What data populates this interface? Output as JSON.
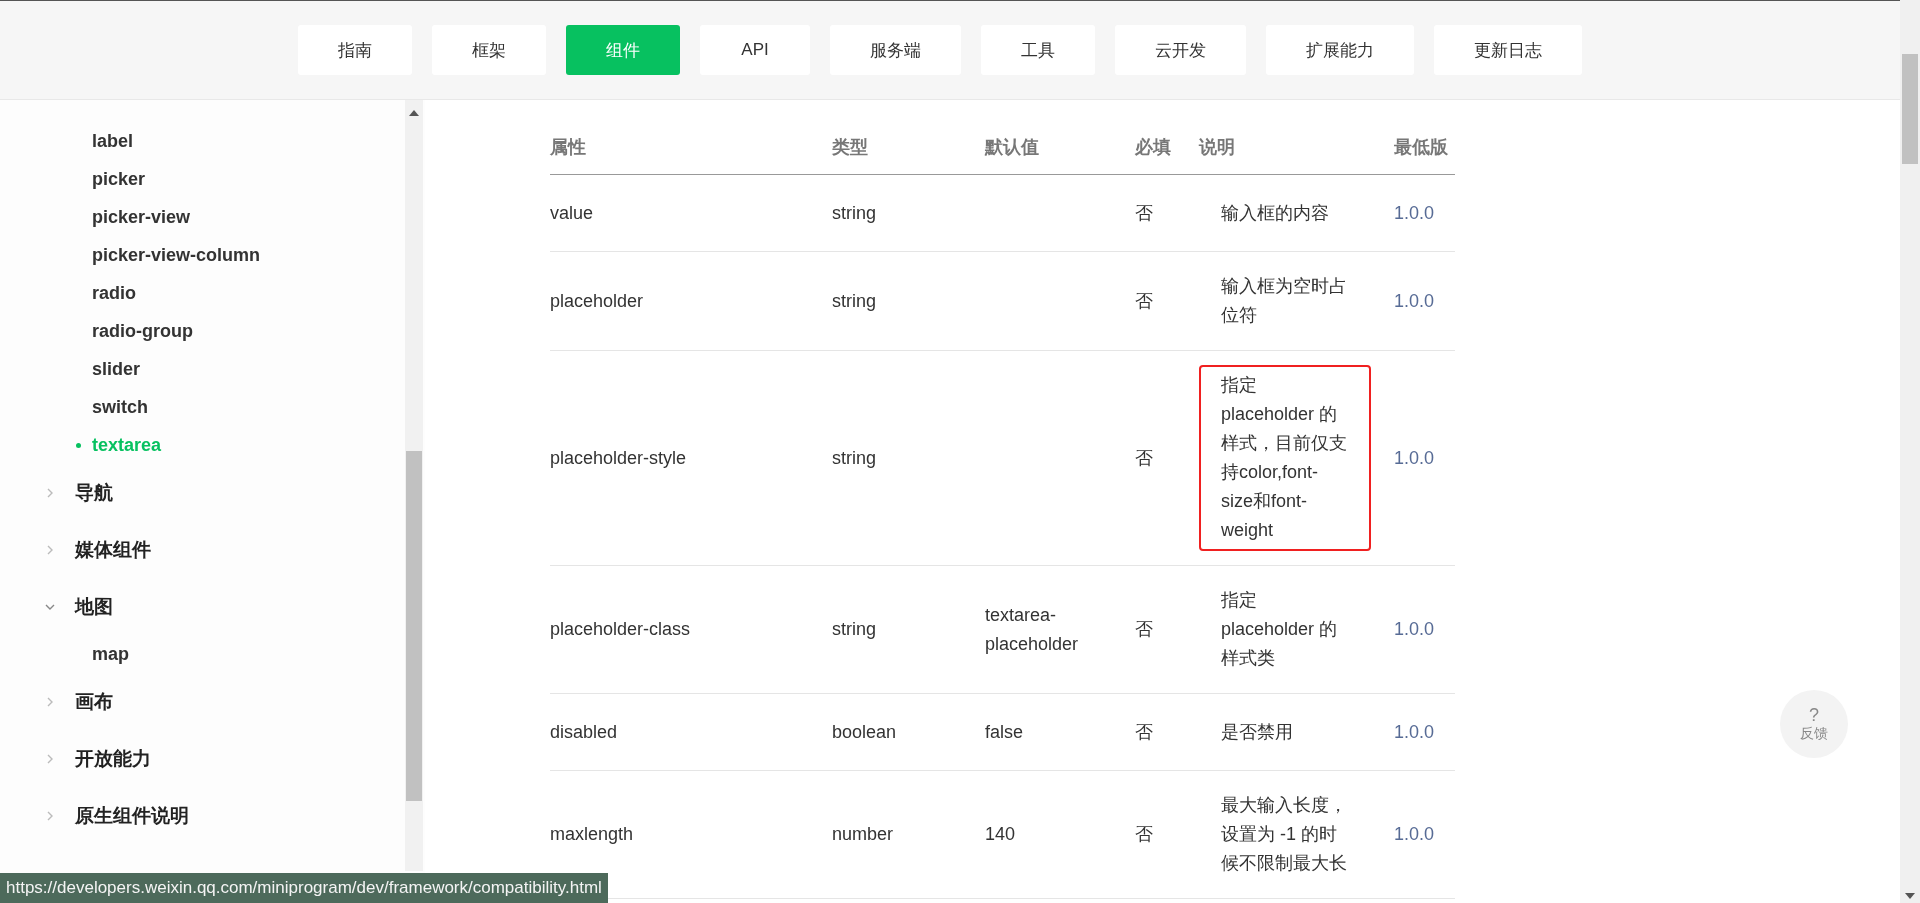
{
  "nav": [
    {
      "label": "指南",
      "selected": false
    },
    {
      "label": "框架",
      "selected": false
    },
    {
      "label": "组件",
      "selected": true
    },
    {
      "label": "API",
      "selected": false
    },
    {
      "label": "服务端",
      "selected": false
    },
    {
      "label": "工具",
      "selected": false
    },
    {
      "label": "云开发",
      "selected": false
    },
    {
      "label": "扩展能力",
      "selected": false
    },
    {
      "label": "更新日志",
      "selected": false
    }
  ],
  "sidebar": {
    "sub_items": [
      {
        "label": "label",
        "selected": false
      },
      {
        "label": "picker",
        "selected": false
      },
      {
        "label": "picker-view",
        "selected": false
      },
      {
        "label": "picker-view-column",
        "selected": false
      },
      {
        "label": "radio",
        "selected": false
      },
      {
        "label": "radio-group",
        "selected": false
      },
      {
        "label": "slider",
        "selected": false
      },
      {
        "label": "switch",
        "selected": false
      },
      {
        "label": "textarea",
        "selected": true
      }
    ],
    "groups": [
      {
        "label": "导航",
        "expanded": false
      },
      {
        "label": "媒体组件",
        "expanded": false
      },
      {
        "label": "地图",
        "expanded": true,
        "children": [
          {
            "label": "map",
            "selected": false
          }
        ]
      },
      {
        "label": "画布",
        "expanded": false
      },
      {
        "label": "开放能力",
        "expanded": false
      },
      {
        "label": "原生组件说明",
        "expanded": false
      }
    ]
  },
  "table": {
    "columns": [
      "属性",
      "类型",
      "默认值",
      "必填",
      "说明",
      "最低版"
    ],
    "rows": [
      {
        "name": "value",
        "type": "string",
        "default": "",
        "required": "否",
        "description": "输入框的内容",
        "version": "1.0.0",
        "highlighted": false
      },
      {
        "name": "placeholder",
        "type": "string",
        "default": "",
        "required": "否",
        "description": "输入框为空时占位符",
        "version": "1.0.0",
        "highlighted": false
      },
      {
        "name": "placeholder-style",
        "type": "string",
        "default": "",
        "required": "否",
        "description": "指定 placeholder 的样式，目前仅支持color,font-size和font-weight",
        "version": "1.0.0",
        "highlighted": true
      },
      {
        "name": "placeholder-class",
        "type": "string",
        "default": "textarea-placeholder",
        "required": "否",
        "description": "指定 placeholder 的样式类",
        "version": "1.0.0",
        "highlighted": false
      },
      {
        "name": "disabled",
        "type": "boolean",
        "default": "false",
        "required": "否",
        "description": "是否禁用",
        "version": "1.0.0",
        "highlighted": false
      },
      {
        "name": "maxlength",
        "type": "number",
        "default": "140",
        "required": "否",
        "description": "最大输入长度，设置为 -1 的时候不限制最大长",
        "version": "1.0.0",
        "highlighted": false
      }
    ]
  },
  "feedback": {
    "icon": "?",
    "label": "反馈"
  },
  "status_bar": "https://developers.weixin.qq.com/miniprogram/dev/framework/compatibility.html"
}
